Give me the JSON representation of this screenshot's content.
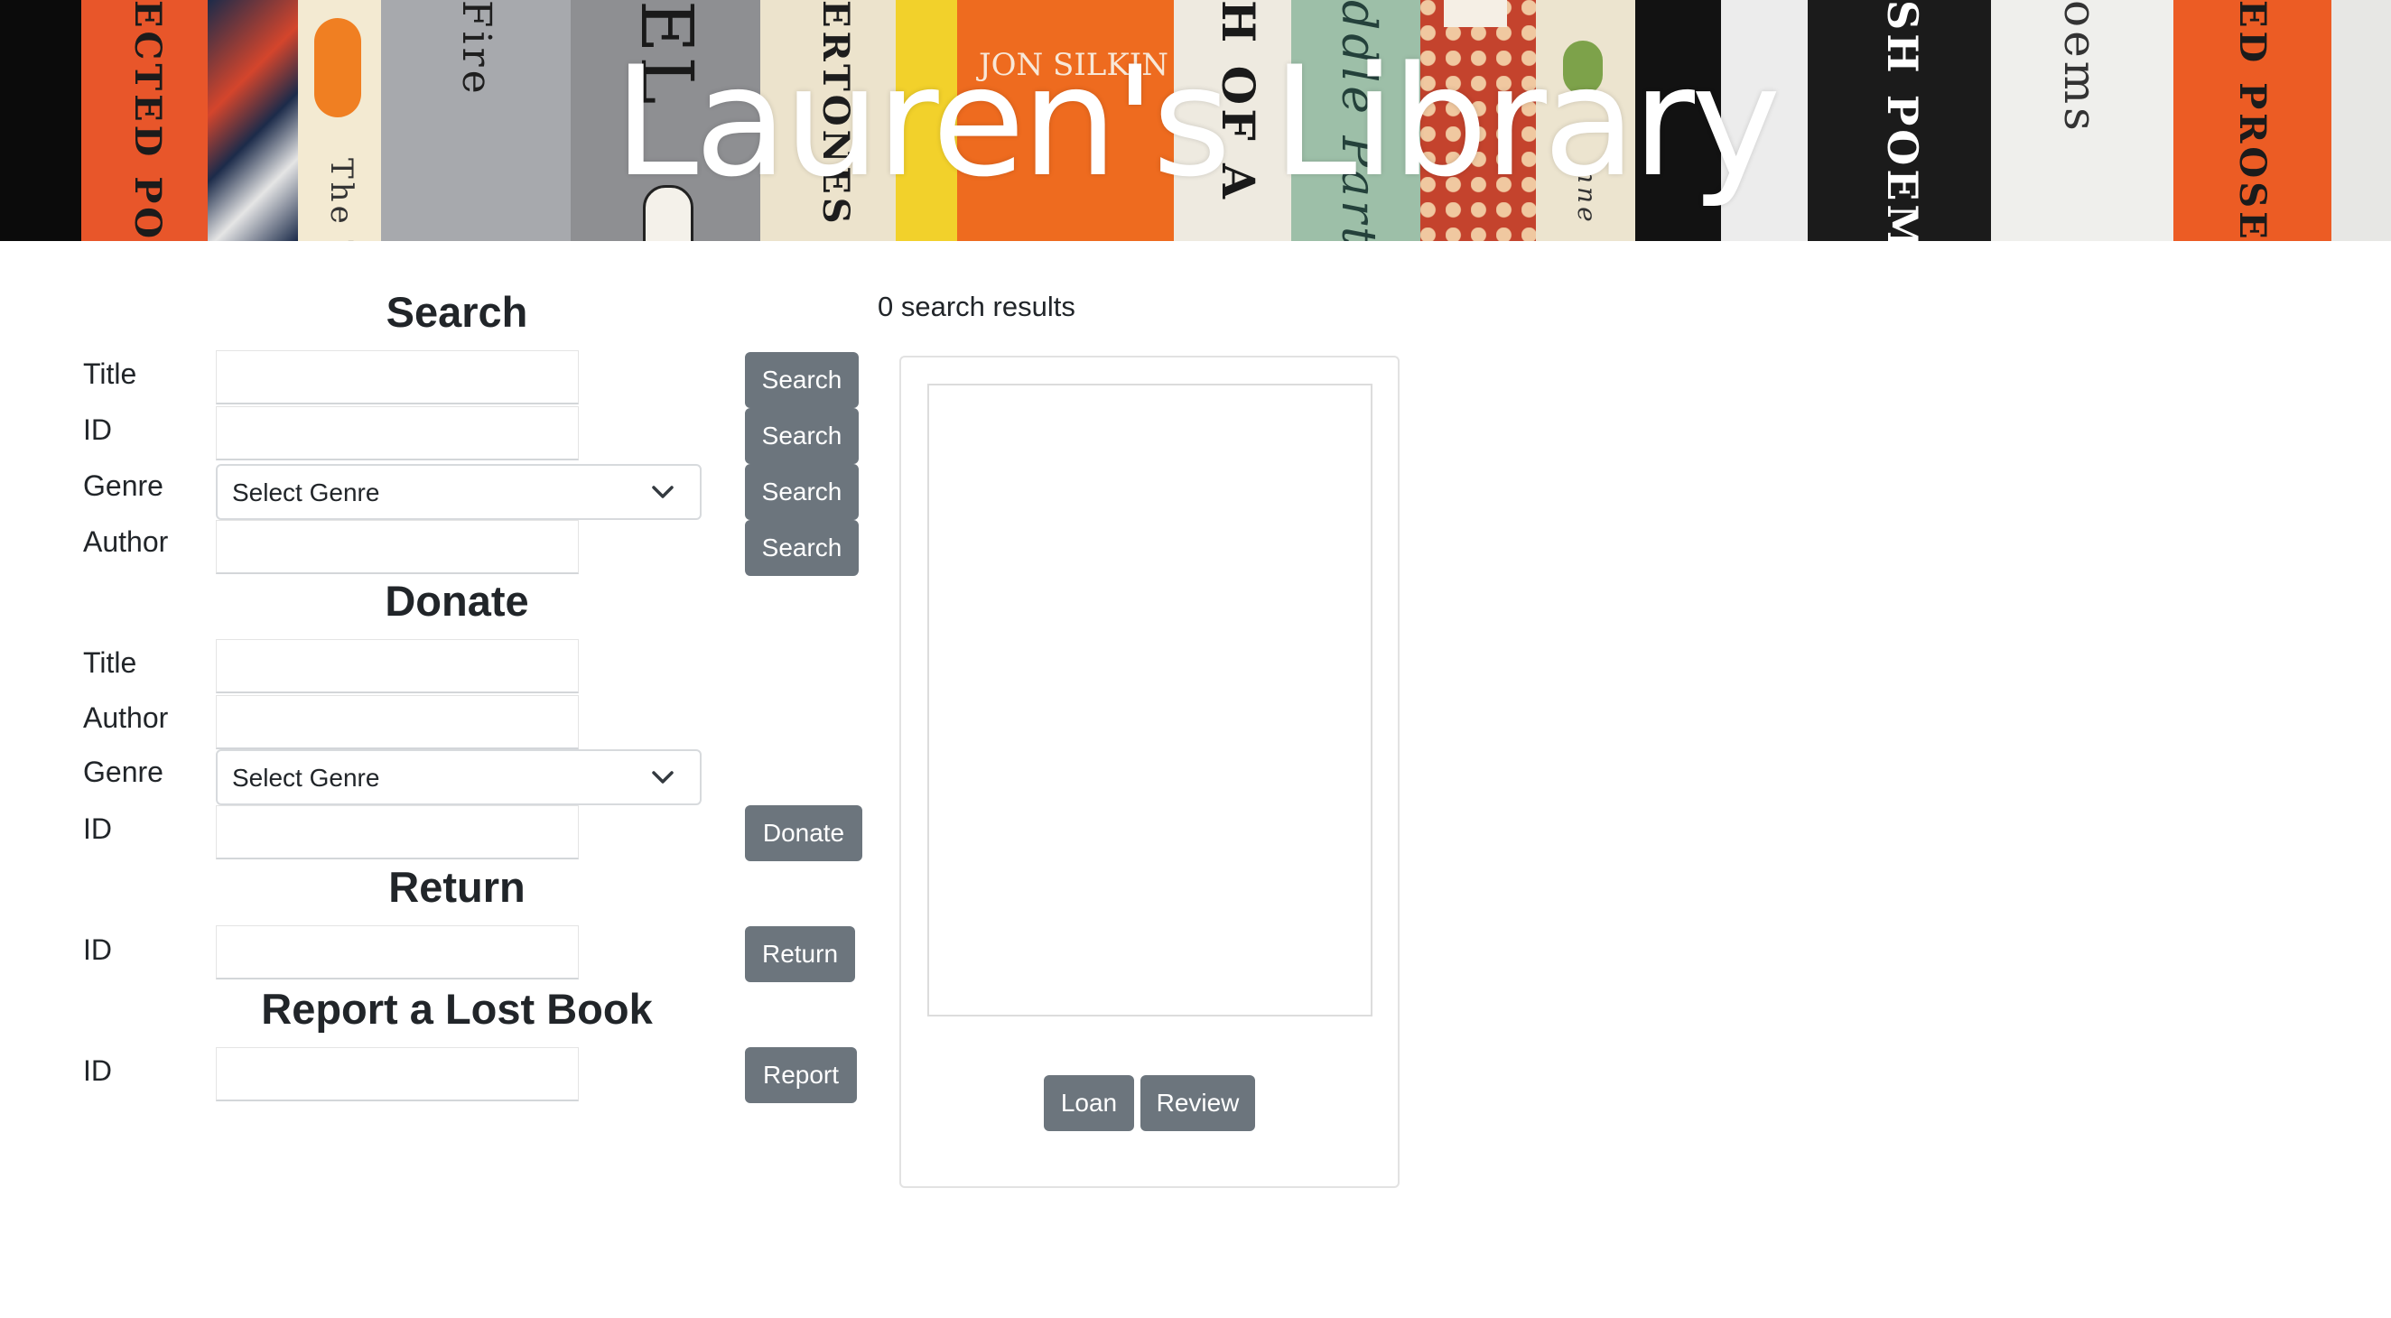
{
  "header": {
    "title": "Lauren's Library",
    "spine_texts": [
      "ECTED POEM",
      "Fire",
      "EL",
      "ERTONES C",
      "JON SILKIN",
      "H OF A",
      "ddle Parts",
      "nne",
      "SH POEMS",
      "oems",
      "ED PROSE",
      "The T"
    ]
  },
  "search": {
    "heading": "Search",
    "title_label": "Title",
    "id_label": "ID",
    "genre_label": "Genre",
    "author_label": "Author",
    "title_value": "",
    "id_value": "",
    "author_value": "",
    "genre_selected": "Select Genre",
    "button_label": "Search"
  },
  "donate": {
    "heading": "Donate",
    "title_label": "Title",
    "author_label": "Author",
    "genre_label": "Genre",
    "id_label": "ID",
    "title_value": "",
    "author_value": "",
    "id_value": "",
    "genre_selected": "Select Genre",
    "button_label": "Donate"
  },
  "return": {
    "heading": "Return",
    "id_label": "ID",
    "id_value": "",
    "button_label": "Return"
  },
  "report": {
    "heading": "Report a Lost Book",
    "id_label": "ID",
    "id_value": "",
    "button_label": "Report"
  },
  "results": {
    "count_text": "0 search results",
    "loan_label": "Loan",
    "review_label": "Review"
  },
  "colors": {
    "button_bg": "#6c757d",
    "button_text": "#ffffff",
    "text": "#212529"
  }
}
